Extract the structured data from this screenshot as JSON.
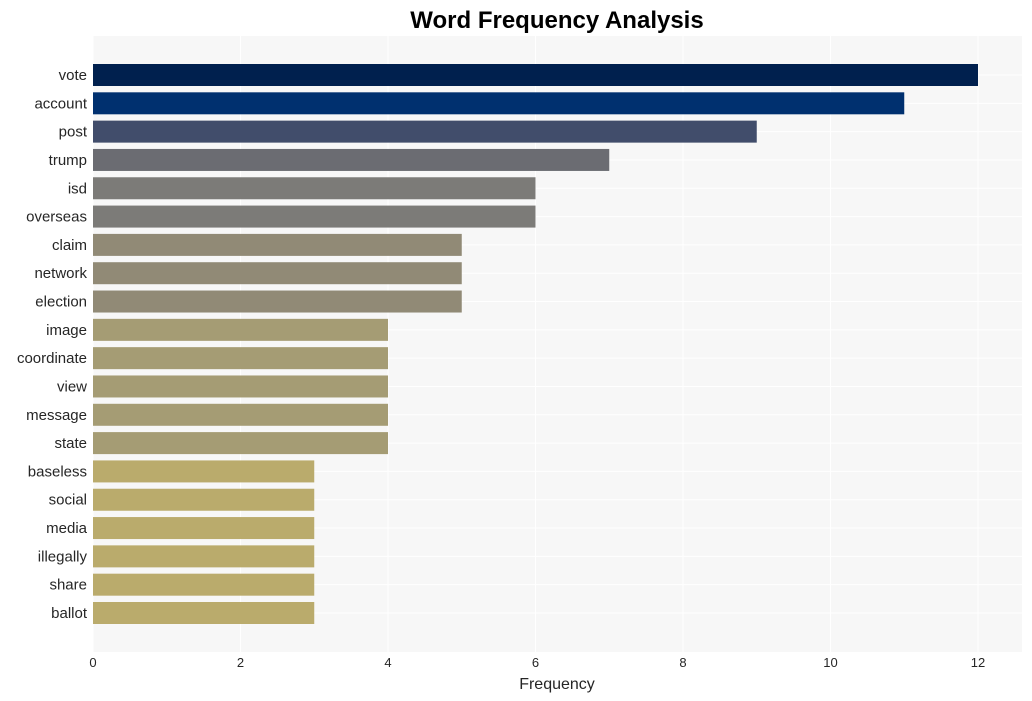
{
  "chart_data": {
    "type": "bar",
    "orientation": "horizontal",
    "title": "Word Frequency Analysis",
    "xlabel": "Frequency",
    "ylabel": "",
    "xlim": [
      0,
      12.6
    ],
    "xticks": [
      0,
      2,
      4,
      6,
      8,
      10,
      12
    ],
    "grid": true,
    "legend": "none",
    "categories": [
      "vote",
      "account",
      "post",
      "trump",
      "isd",
      "overseas",
      "claim",
      "network",
      "election",
      "image",
      "coordinate",
      "view",
      "message",
      "state",
      "baseless",
      "social",
      "media",
      "illegally",
      "share",
      "ballot"
    ],
    "values": [
      12,
      11,
      9,
      7,
      6,
      6,
      5,
      5,
      5,
      4,
      4,
      4,
      4,
      4,
      3,
      3,
      3,
      3,
      3,
      3
    ],
    "colors": [
      "#00204e",
      "#00306f",
      "#414d6b",
      "#6b6c72",
      "#7c7b78",
      "#7c7b78",
      "#918a76",
      "#918a76",
      "#918a76",
      "#a59c74",
      "#a59c74",
      "#a59c74",
      "#a59c74",
      "#a59c74",
      "#baab6c",
      "#baab6c",
      "#baab6c",
      "#baab6c",
      "#baab6c",
      "#baab6c"
    ],
    "plot_background": "#f7f7f7",
    "grid_color": "#ffffff"
  }
}
